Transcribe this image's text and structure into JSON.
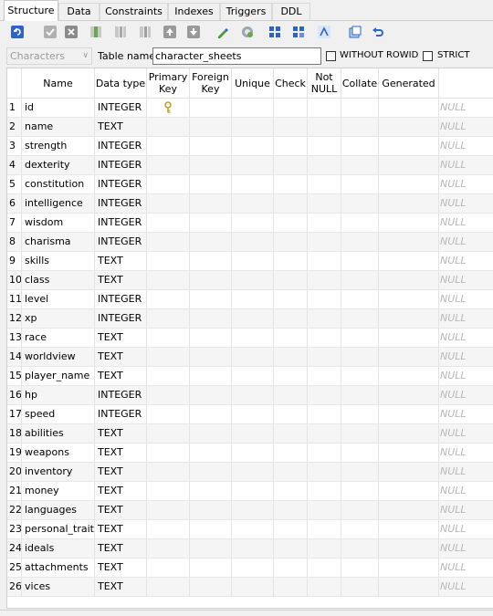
{
  "tabs": [
    "Structure",
    "Data",
    "Constraints",
    "Indexes",
    "Triggers",
    "DDL"
  ],
  "active_tab": "Structure",
  "options": {
    "database": "Characters",
    "table_name_label": "Table name:",
    "table_name": "character_sheets",
    "without_rowid_label": "WITHOUT ROWID",
    "without_rowid_checked": false,
    "strict_label": "STRICT",
    "strict_checked": false
  },
  "columns_header": [
    "",
    "Name",
    "Data type",
    "Primary\nKey",
    "Foreign\nKey",
    "Unique",
    "Check",
    "Not\nNULL",
    "Collate",
    "Generated",
    ""
  ],
  "rows": [
    {
      "n": "1",
      "name": "id",
      "type": "INTEGER",
      "pk": true,
      "default": "NULL"
    },
    {
      "n": "2",
      "name": "name",
      "type": "TEXT",
      "pk": false,
      "default": "NULL"
    },
    {
      "n": "3",
      "name": "strength",
      "type": "INTEGER",
      "pk": false,
      "default": "NULL"
    },
    {
      "n": "4",
      "name": "dexterity",
      "type": "INTEGER",
      "pk": false,
      "default": "NULL"
    },
    {
      "n": "5",
      "name": "constitution",
      "type": "INTEGER",
      "pk": false,
      "default": "NULL"
    },
    {
      "n": "6",
      "name": "intelligence",
      "type": "INTEGER",
      "pk": false,
      "default": "NULL"
    },
    {
      "n": "7",
      "name": "wisdom",
      "type": "INTEGER",
      "pk": false,
      "default": "NULL"
    },
    {
      "n": "8",
      "name": "charisma",
      "type": "INTEGER",
      "pk": false,
      "default": "NULL"
    },
    {
      "n": "9",
      "name": "skills",
      "type": "TEXT",
      "pk": false,
      "default": "NULL"
    },
    {
      "n": "10",
      "name": "class",
      "type": "TEXT",
      "pk": false,
      "default": "NULL"
    },
    {
      "n": "11",
      "name": "level",
      "type": "INTEGER",
      "pk": false,
      "default": "NULL"
    },
    {
      "n": "12",
      "name": "xp",
      "type": "INTEGER",
      "pk": false,
      "default": "NULL"
    },
    {
      "n": "13",
      "name": "race",
      "type": "TEXT",
      "pk": false,
      "default": "NULL"
    },
    {
      "n": "14",
      "name": "worldview",
      "type": "TEXT",
      "pk": false,
      "default": "NULL"
    },
    {
      "n": "15",
      "name": "player_name",
      "type": "TEXT",
      "pk": false,
      "default": "NULL"
    },
    {
      "n": "16",
      "name": "hp",
      "type": "INTEGER",
      "pk": false,
      "default": "NULL"
    },
    {
      "n": "17",
      "name": "speed",
      "type": "INTEGER",
      "pk": false,
      "default": "NULL"
    },
    {
      "n": "18",
      "name": "abilities",
      "type": "TEXT",
      "pk": false,
      "default": "NULL"
    },
    {
      "n": "19",
      "name": "weapons",
      "type": "TEXT",
      "pk": false,
      "default": "NULL"
    },
    {
      "n": "20",
      "name": "inventory",
      "type": "TEXT",
      "pk": false,
      "default": "NULL"
    },
    {
      "n": "21",
      "name": "money",
      "type": "TEXT",
      "pk": false,
      "default": "NULL"
    },
    {
      "n": "22",
      "name": "languages",
      "type": "TEXT",
      "pk": false,
      "default": "NULL"
    },
    {
      "n": "23",
      "name": "personal_traits",
      "type": "TEXT",
      "pk": false,
      "default": "NULL"
    },
    {
      "n": "24",
      "name": "ideals",
      "type": "TEXT",
      "pk": false,
      "default": "NULL"
    },
    {
      "n": "25",
      "name": "attachments",
      "type": "TEXT",
      "pk": false,
      "default": "NULL"
    },
    {
      "n": "26",
      "name": "vices",
      "type": "TEXT",
      "pk": false,
      "default": "NULL"
    }
  ],
  "toolbar_icons": [
    "refresh-structure-icon",
    "commit-icon",
    "rollback-icon",
    "add-column-icon",
    "edit-column-icon",
    "delete-column-icon",
    "move-up-icon",
    "move-down-icon",
    "create-similar-table-icon",
    "reset-autoincrement-icon",
    "add-table-constraint-icon",
    "edit-table-constraint-icon",
    "delete-table-constraint-icon",
    "generate-sql-icon",
    "populate-table-icon",
    "undo-icon"
  ],
  "colors": {
    "accent": "#2e64c8",
    "null_text": "#b8b8b8",
    "key_icon": "#c8a030"
  }
}
